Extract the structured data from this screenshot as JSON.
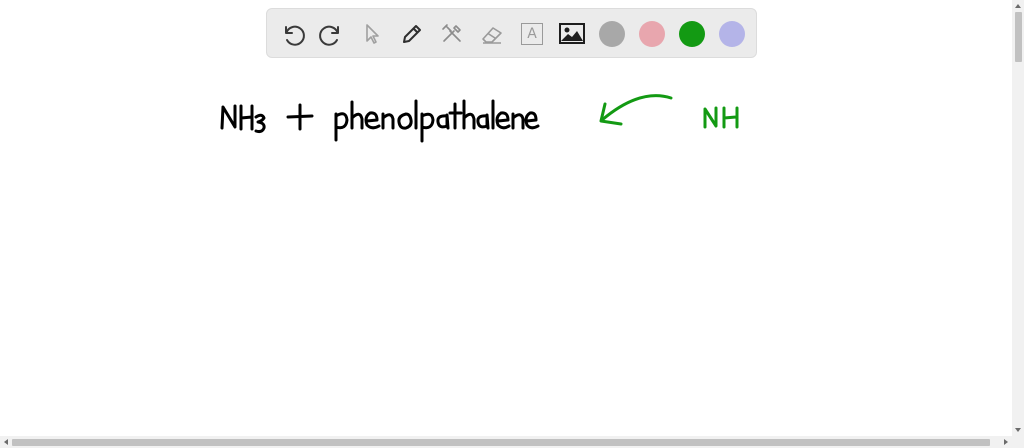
{
  "toolbar": {
    "tools": [
      {
        "icon": "undo-icon"
      },
      {
        "icon": "redo-icon"
      },
      {
        "icon": "pointer-icon"
      },
      {
        "icon": "pen-icon"
      },
      {
        "icon": "tools-icon"
      },
      {
        "icon": "eraser-icon"
      },
      {
        "icon": "text-icon",
        "label": "A"
      },
      {
        "icon": "image-icon"
      }
    ],
    "colors": [
      "#a8a8a8",
      "#e8a6ae",
      "#139a13",
      "#b4b4e8"
    ]
  },
  "canvas": {
    "handwriting": [
      {
        "text": "NH3 + phenolpathalene",
        "color": "#000000"
      },
      {
        "text": "NH",
        "color": "#139a13"
      }
    ],
    "arrow_color": "#139a13"
  }
}
